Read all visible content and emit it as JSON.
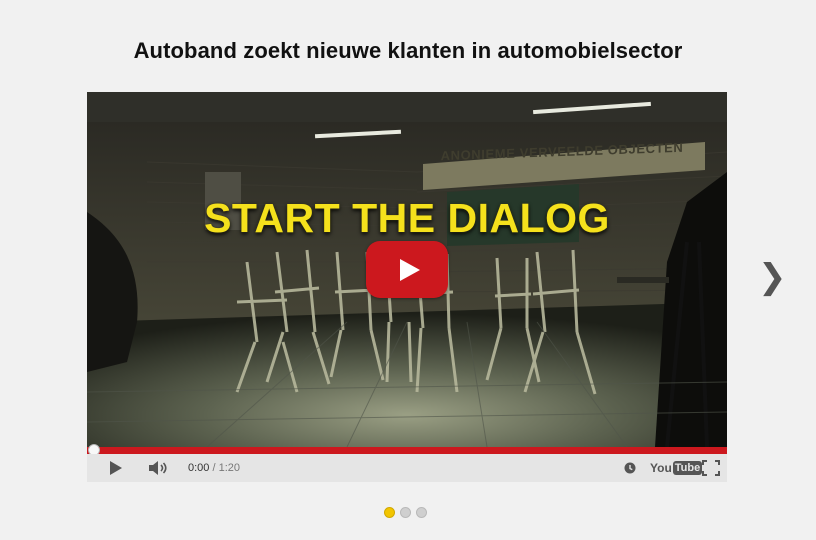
{
  "slide": {
    "title": "Autoband zoekt nieuwe klanten in automobielsector"
  },
  "video": {
    "overlay_title": "START THE DIALOG",
    "sign_text": "ANONIEME VERVEELDE OBJECTEN",
    "current_time": "0:00",
    "time_separator": " / ",
    "duration": "1:20",
    "progress": 0.0,
    "logo_you": "You",
    "logo_tube": "Tube",
    "accent_color": "#cc181e"
  },
  "carousel": {
    "next_symbol": "❯",
    "slides_total": 3,
    "active_index": 0,
    "dot_active_color": "#f2c500"
  },
  "icons": {
    "play": "play-icon",
    "volume": "volume-icon",
    "clock": "watch-later-icon",
    "fullscreen": "fullscreen-icon",
    "youtube": "youtube-logo"
  }
}
